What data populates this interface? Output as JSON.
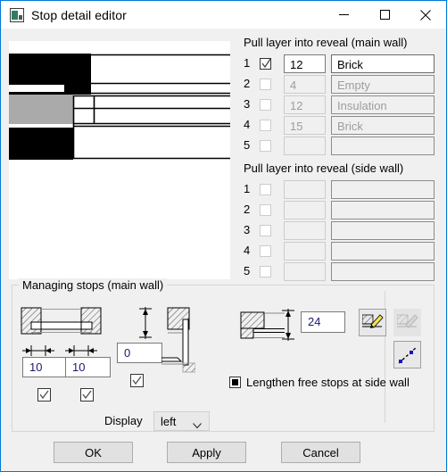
{
  "window": {
    "title": "Stop detail editor",
    "icon": "app-icon",
    "accent": "#0078d7",
    "minimize_label": "─",
    "maximize_label": "□",
    "close_label": "✕"
  },
  "main_wall": {
    "title": "Pull layer into reveal (main wall)",
    "rows": [
      {
        "num": "1",
        "checked": true,
        "enabled": true,
        "value": "12",
        "name": "Brick"
      },
      {
        "num": "2",
        "checked": false,
        "enabled": false,
        "value": "4",
        "name": "Empty"
      },
      {
        "num": "3",
        "checked": false,
        "enabled": false,
        "value": "12",
        "name": "Insulation"
      },
      {
        "num": "4",
        "checked": false,
        "enabled": false,
        "value": "15",
        "name": "Brick"
      },
      {
        "num": "5",
        "checked": false,
        "enabled": false,
        "value": "",
        "name": ""
      }
    ]
  },
  "side_wall": {
    "title": "Pull layer into reveal (side wall)",
    "rows": [
      {
        "num": "1",
        "checked": false,
        "enabled": false,
        "value": "",
        "name": ""
      },
      {
        "num": "2",
        "checked": false,
        "enabled": false,
        "value": "",
        "name": ""
      },
      {
        "num": "3",
        "checked": false,
        "enabled": false,
        "value": "",
        "name": ""
      },
      {
        "num": "4",
        "checked": false,
        "enabled": false,
        "value": "",
        "name": ""
      },
      {
        "num": "5",
        "checked": false,
        "enabled": false,
        "value": "",
        "name": ""
      }
    ]
  },
  "managing_stops": {
    "title": "Managing stops (main wall)",
    "left_width_value": "10",
    "right_width_value": "10",
    "offset_value": "0",
    "height_value": "24",
    "left_width_checked": true,
    "right_width_checked": true,
    "offset_checked": true,
    "display_label": "Display",
    "display_value": "left",
    "lengthen_label": "Lengthen free stops at side wall",
    "lengthen_state": "indeterminate",
    "tool_edit": "edit-stop-icon",
    "tool_remove": "remove-stop-icon",
    "tool_polyline": "polyline-icon"
  },
  "footer": {
    "ok": "OK",
    "apply": "Apply",
    "cancel": "Cancel"
  }
}
